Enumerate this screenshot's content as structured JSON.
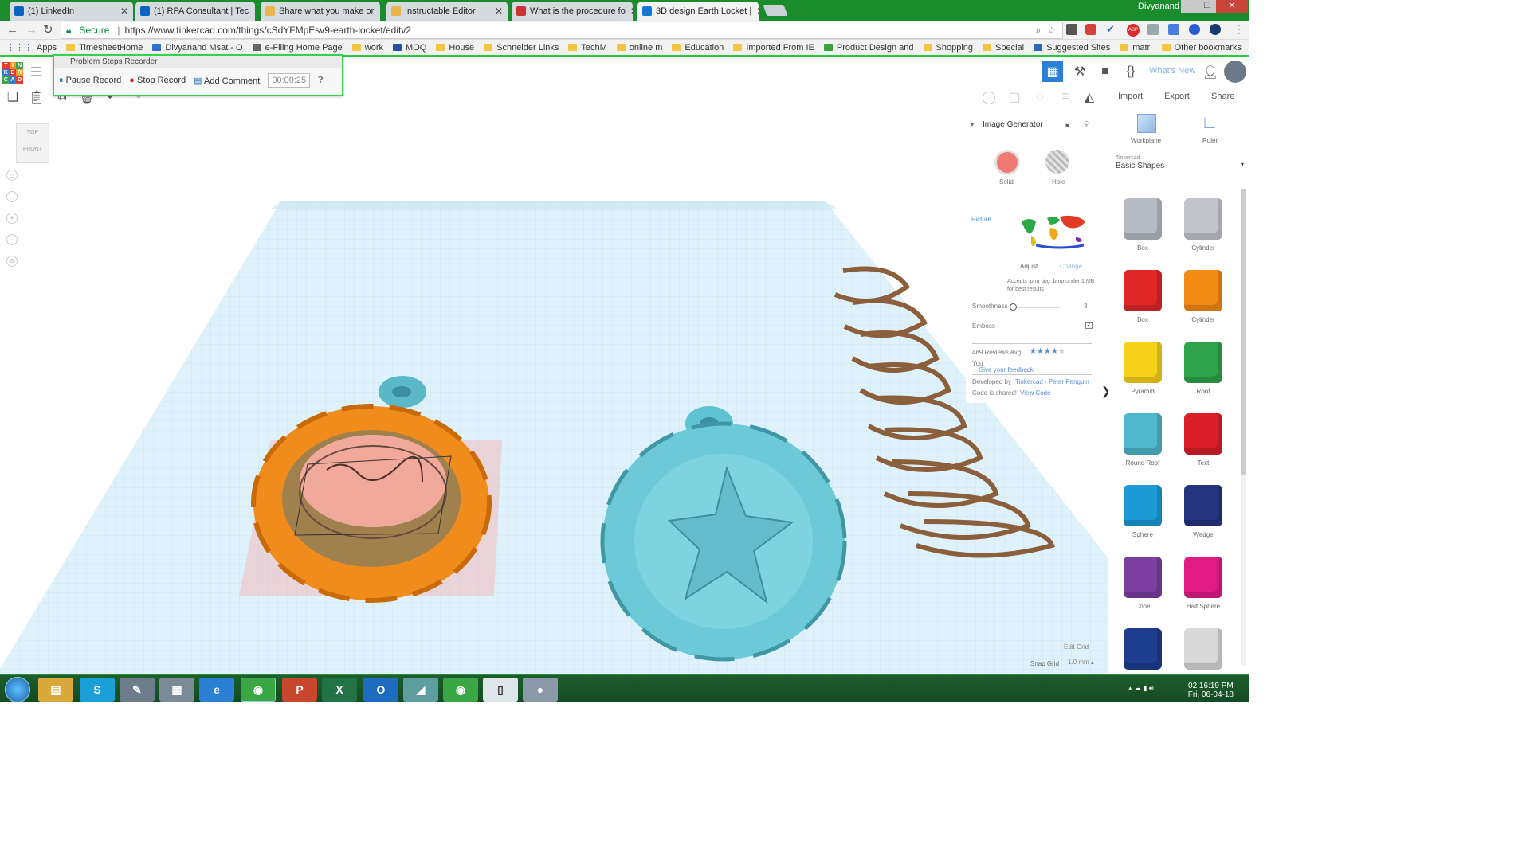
{
  "browser": {
    "tabs": [
      {
        "label": "(1) LinkedIn",
        "color": "#0a66c2"
      },
      {
        "label": "(1) RPA Consultant | Tec",
        "color": "#0a66c2"
      },
      {
        "label": "Share what you make or",
        "color": "#e8b64c"
      },
      {
        "label": "Instructable Editor",
        "color": "#e8b64c"
      },
      {
        "label": "What is the procedure fo",
        "color": "#c33"
      },
      {
        "label": "3D design Earth Locket |",
        "color": "#1477d4"
      }
    ],
    "user": "Divyanand",
    "secure_label": "Secure",
    "url": "https://www.tinkercad.com/things/cSdYFMpEsv9-earth-locket/editv2",
    "bookmarks": [
      "Apps",
      "TimesheetHome",
      "Divyanand Msat - O",
      "e-Filing Home Page",
      "work",
      "MOQ",
      "House",
      "Schneider Links",
      "TechM",
      "online m",
      "Education",
      "Imported From IE",
      "Product Design and",
      "Shopping",
      "Special",
      "Suggested Sites",
      "matri"
    ],
    "other_bookmarks": "Other bookmarks"
  },
  "psr": {
    "title": "Problem Steps Recorder",
    "pause": "Pause Record",
    "stop": "Stop Record",
    "comment": "Add Comment",
    "timer": "00:00:25"
  },
  "toolbar": {
    "whats_new": "What's New",
    "import": "Import",
    "export": "Export",
    "share": "Share"
  },
  "viewcube": {
    "top": "TOP",
    "front": "FRONT"
  },
  "inspector": {
    "title": "Image Generator",
    "solid": "Solid",
    "hole": "Hole",
    "picture": "Picture",
    "adjust": "Adjust",
    "change": "Change",
    "accepts": "Accepts .png .jpg .bmp under 1 MB for best results",
    "smoothness": "Smoothness",
    "smoothness_value": "3",
    "emboss": "Emboss",
    "reviews": "489 Reviews Avg",
    "rating": 4,
    "you": "You",
    "feedback": "Give your feedback",
    "developed": "Developed by",
    "developer": "Tinkercad - Peter Penguin",
    "code_shared": "Code is shared!",
    "view_code": "View Code"
  },
  "sidebar": {
    "workplane": "Workplane",
    "ruler": "Ruler",
    "library_brand": "Tinkercad",
    "library": "Basic Shapes",
    "shapes": [
      {
        "label": "Box",
        "color": "#b7bcc4"
      },
      {
        "label": "Cylinder",
        "color": "#c2c6cc"
      },
      {
        "label": "Box",
        "color": "#e02727"
      },
      {
        "label": "Cylinder",
        "color": "#f28a14"
      },
      {
        "label": "Pyramid",
        "color": "#f7d21b"
      },
      {
        "label": "Roof",
        "color": "#2ea34a"
      },
      {
        "label": "Round Roof",
        "color": "#4fb8cc"
      },
      {
        "label": "Text",
        "color": "#d81f2a"
      },
      {
        "label": "Sphere",
        "color": "#1b9ad6"
      },
      {
        "label": "Wedge",
        "color": "#24347f"
      },
      {
        "label": "Cone",
        "color": "#7b3fa0"
      },
      {
        "label": "Half Sphere",
        "color": "#e01b86"
      },
      {
        "label": "",
        "color": "#1e3d8f"
      },
      {
        "label": "",
        "color": "#d8d8d8"
      }
    ]
  },
  "grid": {
    "edit": "Edit Grid",
    "snap": "Snap Grid",
    "snap_value": "1.0 mm"
  },
  "clock": {
    "time": "02:16:19 PM",
    "date": "Fri, 06-04-18"
  }
}
